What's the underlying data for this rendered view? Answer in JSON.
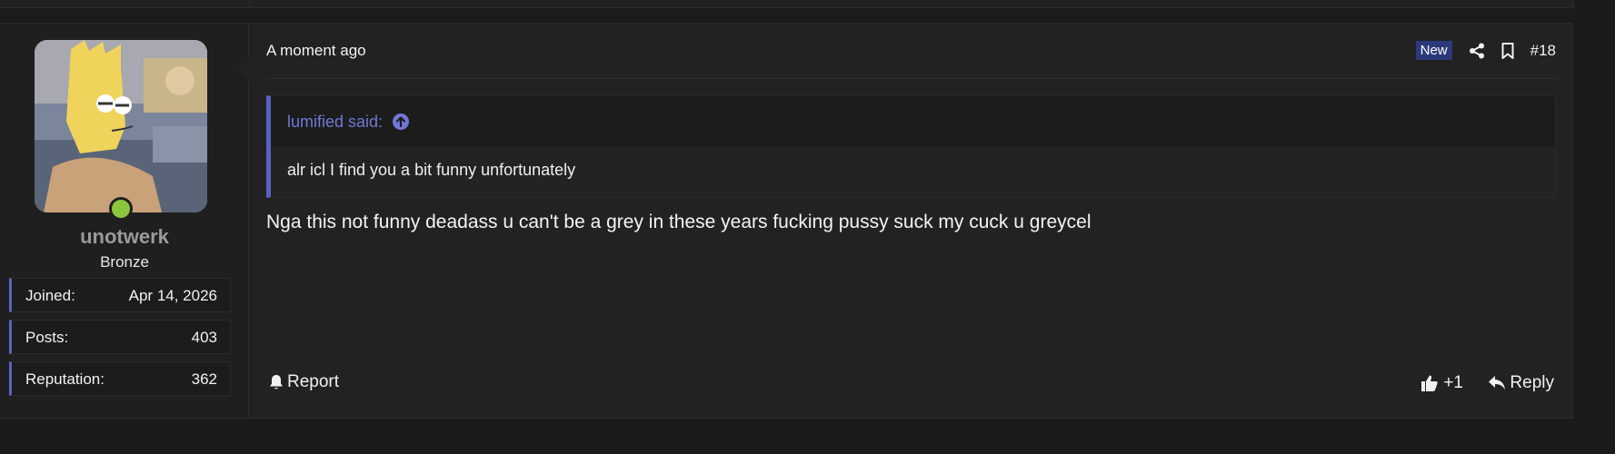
{
  "post": {
    "user": {
      "username": "unotwerk",
      "rank": "Bronze",
      "stats": [
        {
          "label": "Joined:",
          "value": "Apr 14, 2026"
        },
        {
          "label": "Posts:",
          "value": "403"
        },
        {
          "label": "Reputation:",
          "value": "362"
        }
      ],
      "online_color": "#8cc63f"
    },
    "header": {
      "date": "A moment ago",
      "badge": "New",
      "post_number": "#18"
    },
    "quote": {
      "author_line": "lumified said:",
      "text": "alr icl I find you a bit funny unfortunately"
    },
    "message": "Nga this not funny deadass u can't be a grey in these years fucking pussy suck my cuck u greycel",
    "footer": {
      "report_label": "Report",
      "like_count": "+1",
      "reply_label": "Reply"
    },
    "colors": {
      "accent": "#5a62c4",
      "quote_link": "#6f78d6",
      "new_badge": "#2b3a7a"
    }
  }
}
